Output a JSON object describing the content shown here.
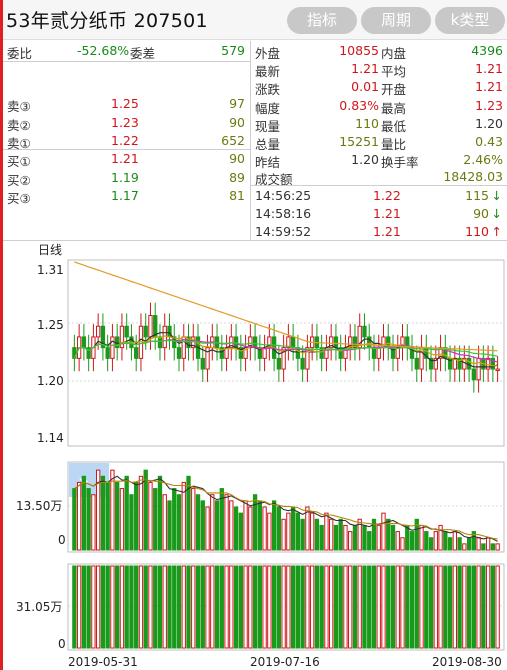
{
  "title": "53年贰分纸币 207501",
  "buttons": {
    "indicator": "指标",
    "period": "周期",
    "ktype": "k类型"
  },
  "left": {
    "weibi": {
      "label": "委比",
      "value": "-52.68%",
      "label2": "委差",
      "value2": "579"
    },
    "sells": [
      {
        "label": "卖③",
        "price": "1.25",
        "vol": "97"
      },
      {
        "label": "卖②",
        "price": "1.23",
        "vol": "90"
      },
      {
        "label": "卖①",
        "price": "1.22",
        "vol": "652"
      }
    ],
    "buys": [
      {
        "label": "买①",
        "price": "1.21",
        "vol": "90"
      },
      {
        "label": "买②",
        "price": "1.19",
        "vol": "89"
      },
      {
        "label": "买③",
        "price": "1.17",
        "vol": "81"
      }
    ]
  },
  "right": {
    "rows": [
      {
        "l1": "外盘",
        "v1": "10855",
        "l2": "内盘",
        "v2": "4396"
      },
      {
        "l1": "最新",
        "v1": "1.21",
        "l2": "平均",
        "v2": "1.21"
      },
      {
        "l1": "涨跌",
        "v1": "0.01",
        "l2": "开盘",
        "v2": "1.21"
      },
      {
        "l1": "幅度",
        "v1": "0.83%",
        "l2": "最高",
        "v2": "1.23"
      },
      {
        "l1": "现量",
        "v1": "110",
        "l2": "最低",
        "v2": "1.20"
      },
      {
        "l1": "总量",
        "v1": "15251",
        "l2": "量比",
        "v2": "0.43"
      },
      {
        "l1": "昨结",
        "v1": "1.20",
        "l2": "换手率",
        "v2": "2.46%"
      }
    ],
    "turnover": {
      "label": "成交额",
      "value": "18428.03"
    },
    "ticks": [
      {
        "time": "14:56:25",
        "price": "1.22",
        "vol": "115",
        "arrow": "↓"
      },
      {
        "time": "14:58:16",
        "price": "1.21",
        "vol": "90",
        "arrow": "↓"
      },
      {
        "time": "14:59:52",
        "price": "1.21",
        "vol": "110",
        "arrow": "↑"
      }
    ]
  },
  "chart": {
    "period_label": "日线",
    "price_ticks": [
      "1.31",
      "1.25",
      "1.20",
      "1.14"
    ],
    "vol_label": "13.50万",
    "vol_zero": "0",
    "amt_label": "31.05万",
    "amt_zero": "0",
    "dates": [
      "2019-05-31",
      "2019-07-16",
      "2019-08-30"
    ]
  },
  "chart_data": {
    "type": "candlestick",
    "period": "日线",
    "x_labels": [
      "2019-05-31",
      "2019-07-16",
      "2019-08-30"
    ],
    "price_axis_ticks": [
      1.31,
      1.25,
      1.2,
      1.14
    ],
    "price_ylim": [
      1.14,
      1.31
    ],
    "volume_axis_ticks": [
      "13.50万",
      "0"
    ],
    "amount_axis_ticks": [
      "31.05万",
      "0"
    ],
    "candles_approx": {
      "open": [
        1.23,
        1.22,
        1.24,
        1.23,
        1.22,
        1.24,
        1.25,
        1.23,
        1.22,
        1.24,
        1.23,
        1.25,
        1.24,
        1.23,
        1.22,
        1.25,
        1.24,
        1.26,
        1.24,
        1.23,
        1.25,
        1.24,
        1.23,
        1.22,
        1.24,
        1.23,
        1.24,
        1.22,
        1.21,
        1.23,
        1.24,
        1.23,
        1.22,
        1.23,
        1.24,
        1.23,
        1.22,
        1.23,
        1.24,
        1.23,
        1.22,
        1.23,
        1.24,
        1.22,
        1.21,
        1.23,
        1.24,
        1.23,
        1.22,
        1.21,
        1.23,
        1.24,
        1.23,
        1.22,
        1.23,
        1.24,
        1.23,
        1.22,
        1.23,
        1.24,
        1.23,
        1.25,
        1.24,
        1.23,
        1.22,
        1.23,
        1.24,
        1.23,
        1.22,
        1.23,
        1.24,
        1.23,
        1.22,
        1.21,
        1.23,
        1.22,
        1.21,
        1.22,
        1.23,
        1.22,
        1.21,
        1.22,
        1.21,
        1.22,
        1.21,
        1.2,
        1.22,
        1.21,
        1.22,
        1.21
      ],
      "close": [
        1.22,
        1.24,
        1.23,
        1.22,
        1.24,
        1.25,
        1.23,
        1.22,
        1.24,
        1.23,
        1.25,
        1.24,
        1.23,
        1.22,
        1.25,
        1.24,
        1.26,
        1.24,
        1.23,
        1.25,
        1.24,
        1.23,
        1.22,
        1.24,
        1.23,
        1.24,
        1.22,
        1.21,
        1.23,
        1.24,
        1.23,
        1.22,
        1.23,
        1.24,
        1.23,
        1.22,
        1.23,
        1.24,
        1.23,
        1.22,
        1.23,
        1.24,
        1.22,
        1.21,
        1.23,
        1.24,
        1.23,
        1.22,
        1.21,
        1.23,
        1.24,
        1.23,
        1.22,
        1.23,
        1.24,
        1.23,
        1.22,
        1.23,
        1.24,
        1.23,
        1.25,
        1.24,
        1.23,
        1.22,
        1.23,
        1.24,
        1.23,
        1.22,
        1.23,
        1.24,
        1.23,
        1.22,
        1.21,
        1.23,
        1.22,
        1.21,
        1.22,
        1.23,
        1.22,
        1.21,
        1.22,
        1.21,
        1.22,
        1.21,
        1.2,
        1.22,
        1.21,
        1.22,
        1.21,
        1.21
      ]
    },
    "volume_approx": [
      10,
      11,
      12,
      10,
      9,
      13,
      12,
      11,
      13,
      11,
      10,
      12,
      9,
      11,
      12,
      13,
      11,
      10,
      12,
      9,
      8,
      10,
      9,
      11,
      12,
      10,
      9,
      8,
      7,
      9,
      8,
      10,
      9,
      8,
      7,
      6,
      8,
      7,
      9,
      8,
      7,
      6,
      8,
      7,
      5,
      6,
      7,
      6,
      5,
      7,
      6,
      5,
      4,
      6,
      5,
      4,
      5,
      4,
      3,
      4,
      5,
      4,
      3,
      5,
      4,
      6,
      5,
      4,
      3,
      2,
      4,
      3,
      5,
      4,
      3,
      2,
      3,
      4,
      3,
      2,
      3,
      2,
      1,
      2,
      3,
      2,
      1,
      2,
      1,
      1
    ]
  }
}
